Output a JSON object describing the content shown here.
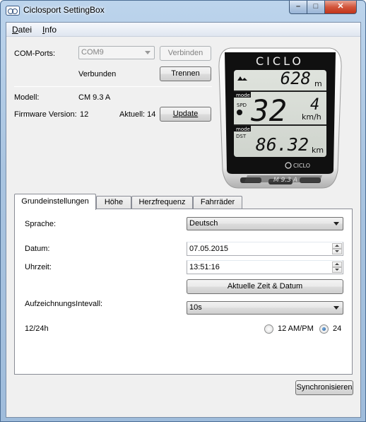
{
  "window": {
    "title": "Ciclosport SettingBox",
    "min_icon": "minimize-icon",
    "max_icon": "maximize-icon",
    "close_icon": "close-icon"
  },
  "menu": [
    {
      "label": "Datei",
      "underline": "D",
      "rest": "atei"
    },
    {
      "label": "Info",
      "underline": "I",
      "rest": "nfo"
    }
  ],
  "connection": {
    "com_label": "COM-Ports:",
    "com_value": "COM9",
    "connect_label": "Verbinden",
    "status": "Verbunden",
    "disconnect_label": "Trennen"
  },
  "device_info": {
    "model_label": "Modell:",
    "model_value": "CM 9.3 A",
    "firmware_label": "Firmware Version:",
    "firmware_value": "12",
    "current_label": "Aktuell: 14",
    "update_label": "Update"
  },
  "display": {
    "brand": "CICLO",
    "alt": "628",
    "alt_unit": "m",
    "speed": "32",
    "speed_dec": "4",
    "speed_unit": "km/h",
    "dist": "86.32",
    "dist_unit": "km",
    "mode1": "mode",
    "mode2": "mode",
    "spd": "SPD",
    "dst": "DST",
    "logo": "CICLO",
    "model_badge": "M 9.3 A"
  },
  "tabs": [
    "Grundeinstellungen",
    "Höhe",
    "Herzfrequenz",
    "Fahrräder"
  ],
  "settings": {
    "language_label": "Sprache:",
    "language_value": "Deutsch",
    "date_label": "Datum:",
    "date_value": "07.05.2015",
    "time_label": "Uhrzeit:",
    "time_value": "13:51:16",
    "current_time_button": "Aktuelle Zeit & Datum",
    "interval_label": "AufzeichnungsIntevall:",
    "interval_value": "10s",
    "clock_label": "12/24h",
    "clock_12": "12 AM/PM",
    "clock_24": "24",
    "clock_selected": "24"
  },
  "sync_button": "Synchronisieren"
}
